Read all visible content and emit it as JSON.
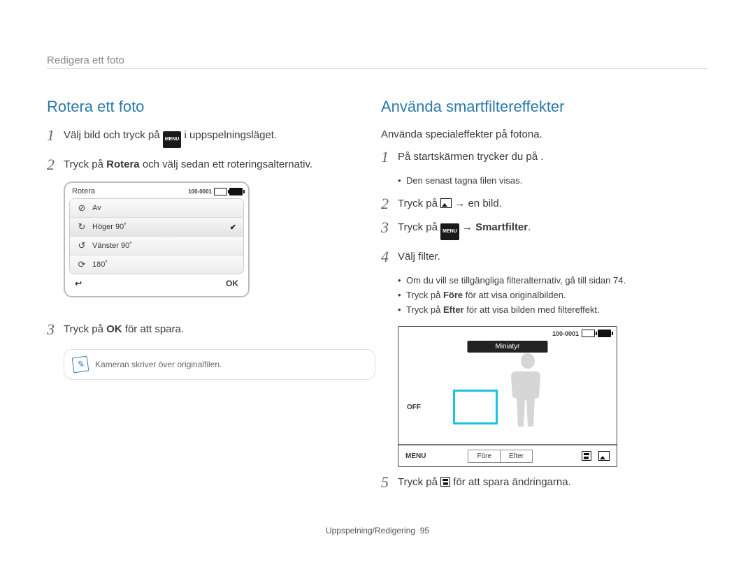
{
  "header": {
    "breadcrumb": "Redigera ett foto"
  },
  "left": {
    "title": "Rotera ett foto",
    "step1_a": "Välj bild och tryck på ",
    "step1_b": " i uppspelningsläget.",
    "step2_a": "Tryck på ",
    "step2_bold": "Rotera",
    "step2_b": " och välj sedan ett roteringsalternativ.",
    "fig": {
      "title": "Rotera",
      "fileid": "100-0001",
      "rows": [
        "Av",
        "Höger 90˚",
        "Vänster 90˚",
        "180˚"
      ],
      "back": "↩",
      "ok": "OK"
    },
    "step3_a": "Tryck på ",
    "step3_ok": "OK",
    "step3_b": " för att spara.",
    "note": "Kameran skriver över originalfilen."
  },
  "right": {
    "title": "Använda smartfiltereffekter",
    "intro": "Använda specialeffekter på fotona.",
    "step1": "På startskärmen trycker du på      .",
    "step1_bullet": "Den senast tagna filen visas.",
    "step2_a": "Tryck på ",
    "step2_b": " → en bild.",
    "step3_a": "Tryck på ",
    "step3_b": " → ",
    "step3_bold": "Smartfilter",
    "step3_c": ".",
    "step4": "Välj filter.",
    "step4_bullets": [
      "Om du vill se tillgängliga filteralternativ, gå till sidan 74.",
      "Tryck på Före för att visa originalbilden.",
      "Tryck på Efter för att visa bilden med filtereffekt."
    ],
    "step4_b2_bold": "Före",
    "step4_b3_bold": "Efter",
    "fig": {
      "fileid": "100-0001",
      "label": "Miniatyr",
      "off": "OFF",
      "menu": "MENU",
      "before": "Före",
      "after": "Efter"
    },
    "step5_a": "Tryck på ",
    "step5_b": " för att spara ändringarna."
  },
  "footer": {
    "section": "Uppspelning/Redigering",
    "page": "95"
  },
  "labels": {
    "menu_small": "MENU"
  }
}
